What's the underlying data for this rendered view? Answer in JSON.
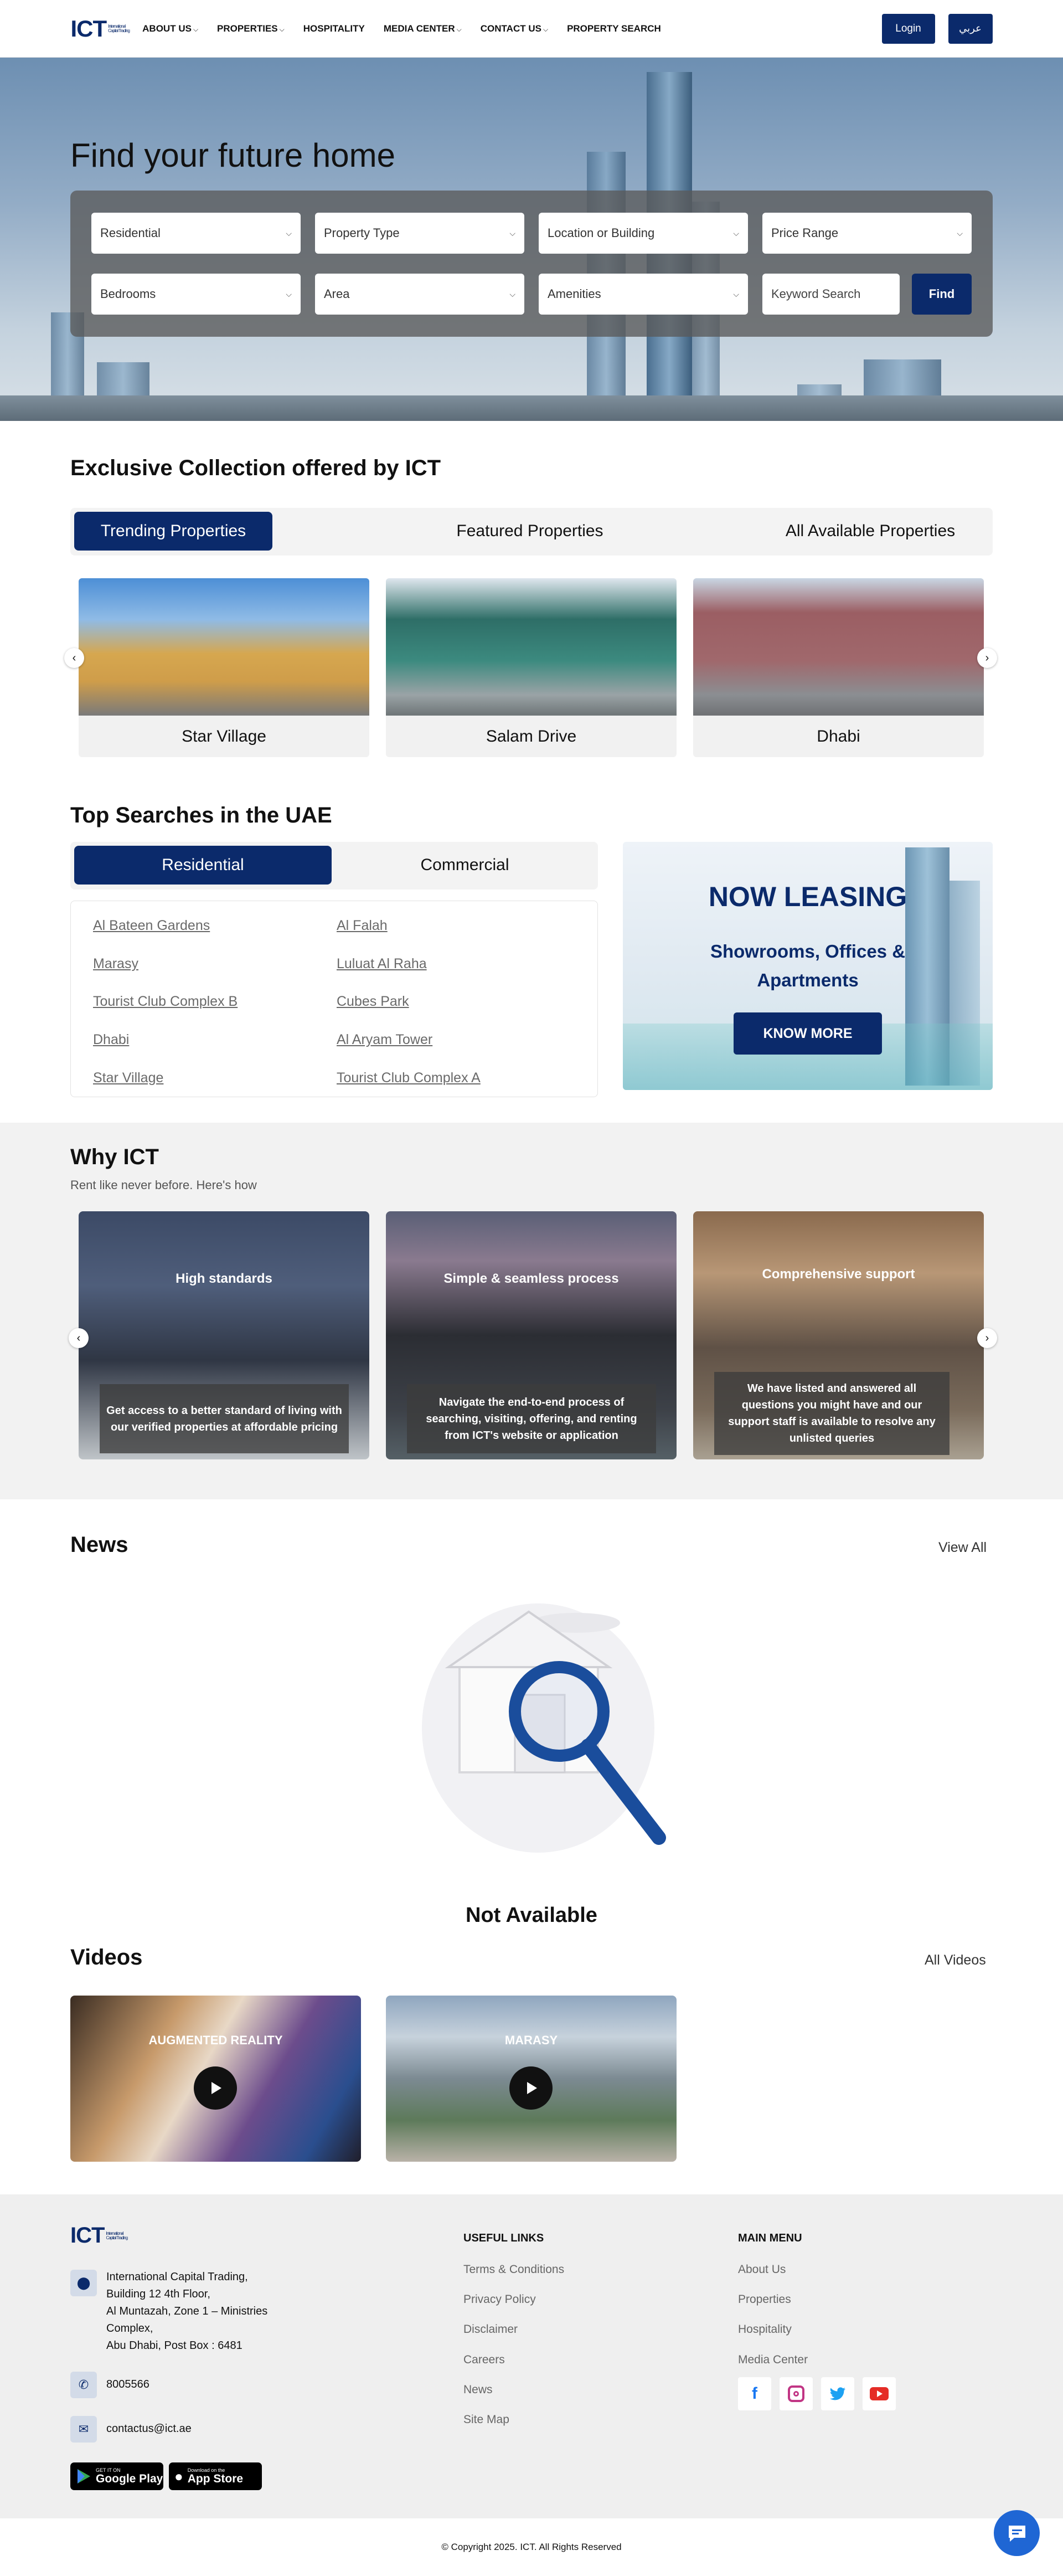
{
  "header": {
    "logo_text": "ICT",
    "logo_sub": "International Capital Trading",
    "nav": [
      {
        "label": "ABOUT US",
        "has_dropdown": true
      },
      {
        "label": "PROPERTIES",
        "has_dropdown": true
      },
      {
        "label": "HOSPITALITY",
        "has_dropdown": false
      },
      {
        "label": "MEDIA CENTER",
        "has_dropdown": true
      },
      {
        "label": "CONTACT US",
        "has_dropdown": true
      },
      {
        "label": "PROPERTY SEARCH",
        "has_dropdown": false
      }
    ],
    "login_label": "Login",
    "lang_label": "عربي"
  },
  "hero": {
    "title": "Find your future home",
    "filters": {
      "category": "Residential",
      "property_type": "Property Type",
      "location": "Location or Building",
      "price": "Price Range",
      "bedrooms": "Bedrooms",
      "area": "Area",
      "amenities": "Amenities",
      "keyword_placeholder": "Keyword Search"
    },
    "find_label": "Find"
  },
  "exclusive": {
    "title": "Exclusive Collection offered by ICT",
    "tabs": [
      "Trending Properties",
      "Featured Properties",
      "All Available Properties"
    ],
    "active_tab": "Trending Properties",
    "properties": [
      "Star Village",
      "Salam Drive",
      "Dhabi"
    ]
  },
  "top_searches": {
    "title": "Top Searches in the UAE",
    "tabs": [
      "Residential",
      "Commercial"
    ],
    "active_tab": "Residential",
    "links_left": [
      "Al Bateen Gardens",
      "Marasy",
      "Tourist Club Complex B",
      "Dhabi",
      "Star Village"
    ],
    "links_right": [
      "Al Falah",
      "Luluat Al Raha",
      "Cubes Park",
      "Al Aryam Tower",
      "Tourist Club Complex A"
    ]
  },
  "leasing": {
    "headline": "NOW LEASING",
    "sub": "Showrooms, Offices & Apartments",
    "cta": "KNOW MORE"
  },
  "why": {
    "title": "Why ICT",
    "subtitle": "Rent like never before. Here's how",
    "cards": [
      {
        "title": "High standards",
        "desc": "Get access to a better standard of living with our verified properties at affordable pricing"
      },
      {
        "title": "Simple & seamless process",
        "desc": "Navigate the end-to-end process of searching, visiting, offering, and renting from ICT's website or application"
      },
      {
        "title": "Comprehensive support",
        "desc": "We have listed and answered all questions you might have and our support staff is available to resolve any unlisted queries"
      }
    ]
  },
  "news": {
    "title": "News",
    "view_all": "View All",
    "empty_text": "Not Available"
  },
  "videos": {
    "title": "Videos",
    "view_all": "All Videos",
    "items": [
      {
        "title": "AUGMENTED REALITY"
      },
      {
        "title": "MARASY"
      }
    ]
  },
  "footer": {
    "address_lines": [
      "International Capital Trading,",
      "Building 12 4th Floor,",
      "Al Muntazah, Zone 1 – Ministries",
      "Complex,",
      "Abu Dhabi, Post Box : 6481"
    ],
    "phone": "8005566",
    "email": "contactus@ict.ae",
    "google_play": {
      "small": "GET IT ON",
      "big": "Google Play"
    },
    "app_store": {
      "small": "Download on the",
      "big": "App Store"
    },
    "useful_links_title": "USEFUL LINKS",
    "useful_links": [
      "Terms & Conditions",
      "Privacy Policy",
      "Disclaimer",
      "Careers",
      "News",
      "Site Map"
    ],
    "main_menu_title": "MAIN MENU",
    "main_menu": [
      "About Us",
      "Properties",
      "Hospitality",
      "Media Center"
    ],
    "social": [
      "facebook-icon",
      "instagram-icon",
      "twitter-icon",
      "youtube-icon"
    ],
    "copyright": "© Copyright 2025. ICT. All Rights Reserved"
  },
  "colors": {
    "brand_navy": "#0b2a6b",
    "chat_blue": "#1f66d4"
  }
}
